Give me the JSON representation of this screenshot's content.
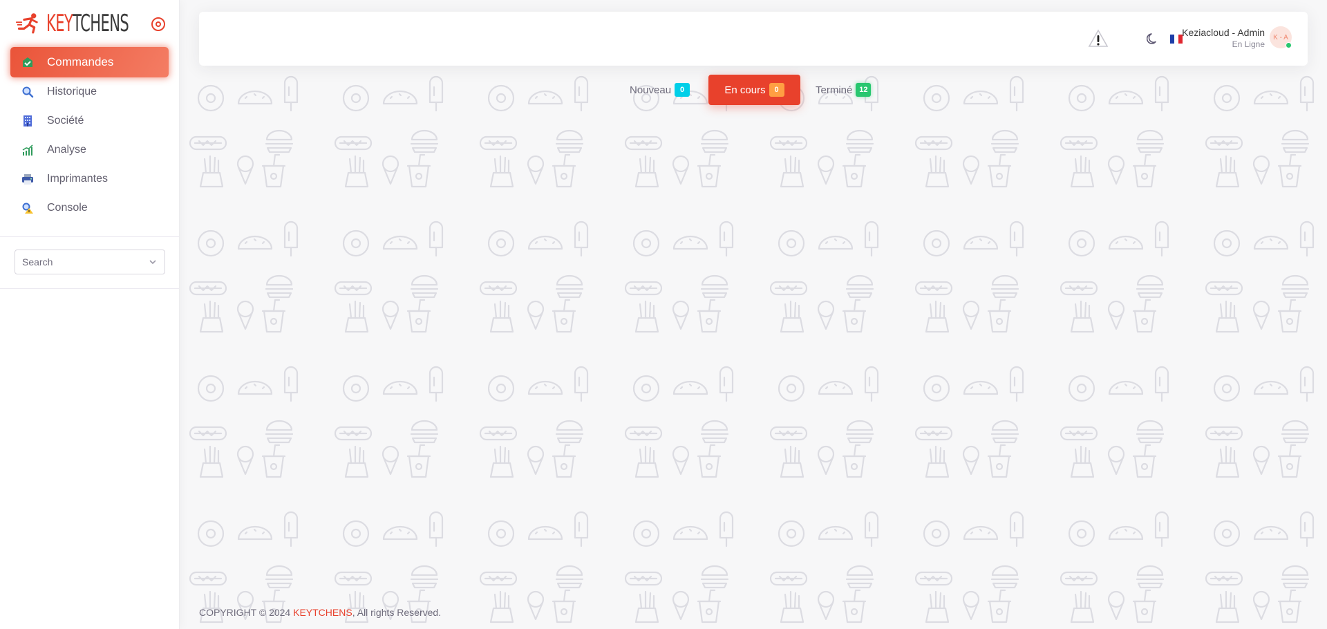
{
  "app": {
    "brand_key": "KEY",
    "brand_rest": "TCHENS",
    "brand_color": "#e8412c"
  },
  "sidebar": {
    "items": [
      {
        "label": "Commandes",
        "icon": "orders-check-icon",
        "active": true
      },
      {
        "label": "Historique",
        "icon": "search-history-icon",
        "active": false
      },
      {
        "label": "Société",
        "icon": "building-icon",
        "active": false
      },
      {
        "label": "Analyse",
        "icon": "chart-icon",
        "active": false
      },
      {
        "label": "Imprimantes",
        "icon": "printer-icon",
        "active": false
      },
      {
        "label": "Console",
        "icon": "console-alert-icon",
        "active": false
      }
    ],
    "search_placeholder": "Search"
  },
  "header": {
    "user_name": "Keziacloud - Admin",
    "user_status": "En Ligne",
    "avatar_initials": "K - A",
    "status_color": "#28c76f"
  },
  "tabs": [
    {
      "label": "Nouveau",
      "count": "0",
      "color": "#00cfe8"
    },
    {
      "label": "En cours",
      "count": "0",
      "color": "#ff9f43",
      "active": true
    },
    {
      "label": "Terminé",
      "count": "12",
      "color": "#28c76f"
    }
  ],
  "footer": {
    "prefix": "COPYRIGHT © 2024 ",
    "brand": "KEYTCHENS",
    "suffix": ", All rights Reserved."
  }
}
